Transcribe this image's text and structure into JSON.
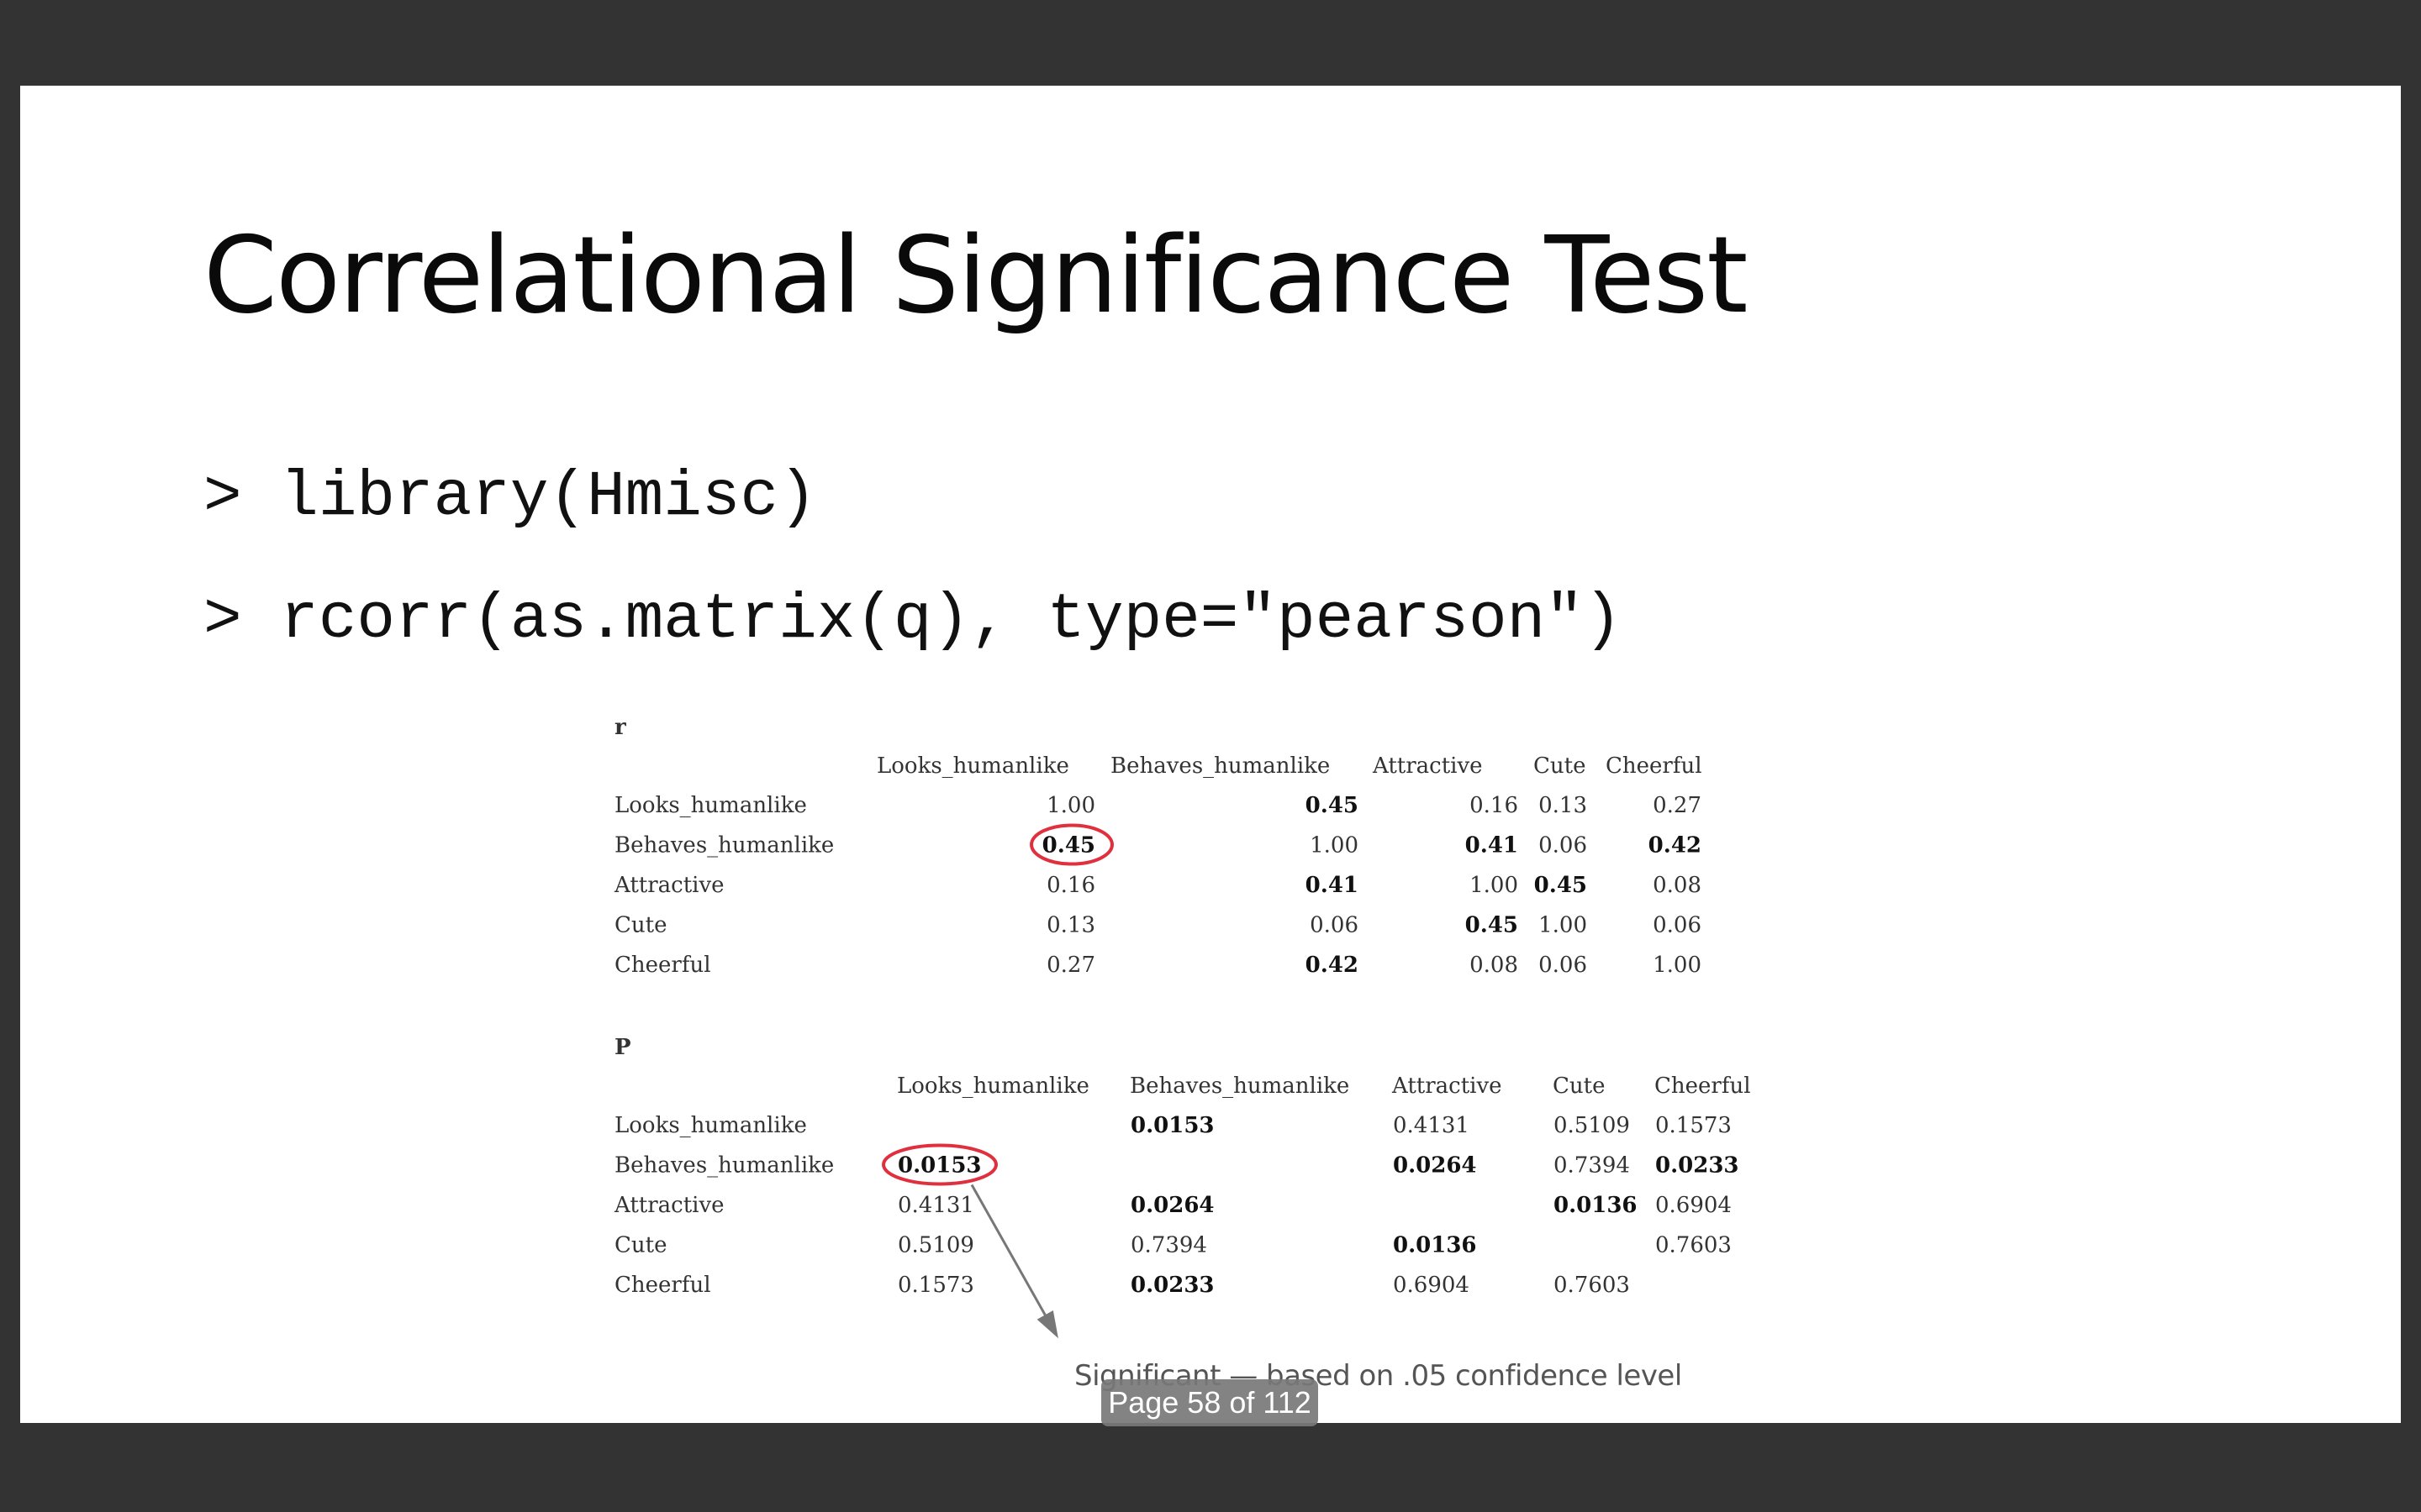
{
  "slide": {
    "title": "Correlational Significance Test",
    "code_lines": [
      "> library(Hmisc)",
      "> rcorr(as.matrix(q), type=\"pearson\")"
    ]
  },
  "output": {
    "r": {
      "label": "r",
      "columns": [
        "Looks_humanlike",
        "Behaves_humanlike",
        "Attractive",
        "Cute",
        "Cheerful"
      ],
      "rows": [
        {
          "name": "Looks_humanlike",
          "cells": [
            {
              "v": "1.00",
              "b": false
            },
            {
              "v": "0.45",
              "b": true
            },
            {
              "v": "0.16",
              "b": false
            },
            {
              "v": "0.13",
              "b": false
            },
            {
              "v": "0.27",
              "b": false
            }
          ]
        },
        {
          "name": "Behaves_humanlike",
          "cells": [
            {
              "v": "0.45",
              "b": true,
              "circled": true
            },
            {
              "v": "1.00",
              "b": false
            },
            {
              "v": "0.41",
              "b": true
            },
            {
              "v": "0.06",
              "b": false
            },
            {
              "v": "0.42",
              "b": true
            }
          ]
        },
        {
          "name": "Attractive",
          "cells": [
            {
              "v": "0.16",
              "b": false
            },
            {
              "v": "0.41",
              "b": true
            },
            {
              "v": "1.00",
              "b": false
            },
            {
              "v": "0.45",
              "b": true
            },
            {
              "v": "0.08",
              "b": false
            }
          ]
        },
        {
          "name": "Cute",
          "cells": [
            {
              "v": "0.13",
              "b": false
            },
            {
              "v": "0.06",
              "b": false
            },
            {
              "v": "0.45",
              "b": true
            },
            {
              "v": "1.00",
              "b": false
            },
            {
              "v": "0.06",
              "b": false
            }
          ]
        },
        {
          "name": "Cheerful",
          "cells": [
            {
              "v": "0.27",
              "b": false
            },
            {
              "v": "0.42",
              "b": true
            },
            {
              "v": "0.08",
              "b": false
            },
            {
              "v": "0.06",
              "b": false
            },
            {
              "v": "1.00",
              "b": false
            }
          ]
        }
      ]
    },
    "p": {
      "label": "P",
      "columns": [
        "Looks_humanlike",
        "Behaves_humanlike",
        "Attractive",
        "Cute",
        "Cheerful"
      ],
      "rows": [
        {
          "name": "Looks_humanlike",
          "cells": [
            {
              "v": "",
              "b": false
            },
            {
              "v": "0.0153",
              "b": true
            },
            {
              "v": "0.4131",
              "b": false
            },
            {
              "v": "0.5109",
              "b": false
            },
            {
              "v": "0.1573",
              "b": false
            }
          ]
        },
        {
          "name": "Behaves_humanlike",
          "cells": [
            {
              "v": "0.0153",
              "b": true,
              "circled": true
            },
            {
              "v": "",
              "b": false
            },
            {
              "v": "0.0264",
              "b": true
            },
            {
              "v": "0.7394",
              "b": false
            },
            {
              "v": "0.0233",
              "b": true
            }
          ]
        },
        {
          "name": "Attractive",
          "cells": [
            {
              "v": "0.4131",
              "b": false
            },
            {
              "v": "0.0264",
              "b": true
            },
            {
              "v": "",
              "b": false
            },
            {
              "v": "0.0136",
              "b": true
            },
            {
              "v": "0.6904",
              "b": false
            }
          ]
        },
        {
          "name": "Cute",
          "cells": [
            {
              "v": "0.5109",
              "b": false
            },
            {
              "v": "0.7394",
              "b": false
            },
            {
              "v": "0.0136",
              "b": true
            },
            {
              "v": "",
              "b": false
            },
            {
              "v": "0.7603",
              "b": false
            }
          ]
        },
        {
          "name": "Cheerful",
          "cells": [
            {
              "v": "0.1573",
              "b": false
            },
            {
              "v": "0.0233",
              "b": true
            },
            {
              "v": "0.6904",
              "b": false
            },
            {
              "v": "0.7603",
              "b": false
            },
            {
              "v": "",
              "b": false
            }
          ]
        }
      ]
    }
  },
  "annotation": {
    "caption": "Significant — based on .05 confidence level",
    "highlight_color": "#e0303e",
    "arrow_color": "#777777"
  },
  "viewer": {
    "page_indicator": "Page 58 of 112",
    "background_color": "#333333"
  }
}
